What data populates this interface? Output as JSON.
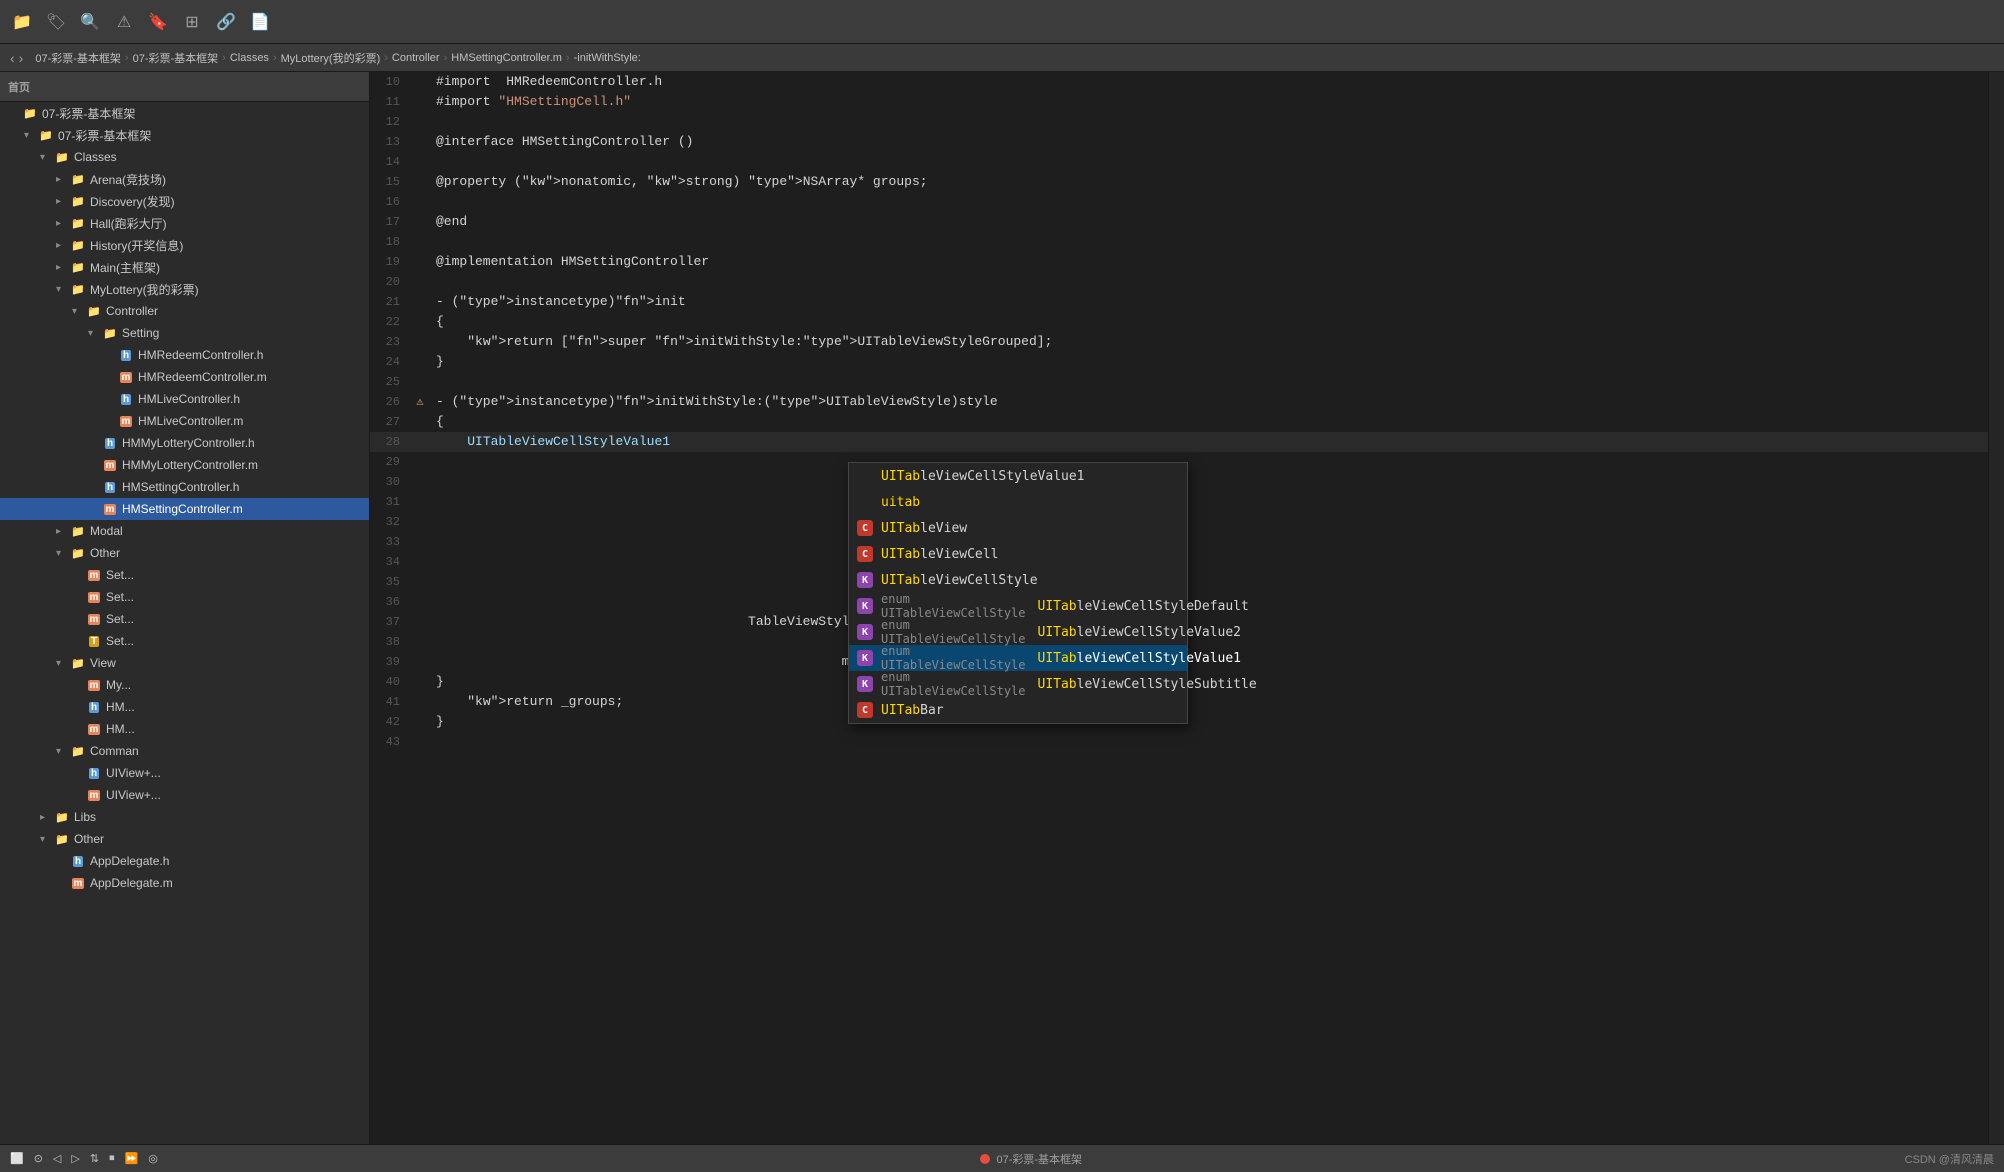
{
  "toolbar": {
    "title": "首页",
    "icons": [
      "folder",
      "tag",
      "search",
      "warning",
      "bookmark",
      "grid",
      "link",
      "doc"
    ]
  },
  "breadcrumb": {
    "nav_back": "‹",
    "nav_forward": "›",
    "items": [
      "07-彩票-基本框架",
      "07-彩票-基本框架",
      "Classes",
      "MyLottery(我的彩票)",
      "Controller",
      "HMSettingController.m",
      "-initWithStyle:"
    ]
  },
  "sidebar": {
    "header": "首页",
    "tree": [
      {
        "label": "07-彩票-基本框架",
        "indent": 1,
        "type": "project",
        "expanded": true
      },
      {
        "label": "07-彩票-基本框架",
        "indent": 2,
        "type": "folder",
        "expanded": true
      },
      {
        "label": "Classes",
        "indent": 3,
        "type": "folder",
        "expanded": true
      },
      {
        "label": "Arena(竞技场)",
        "indent": 4,
        "type": "folder",
        "expanded": false
      },
      {
        "label": "Discovery(发现)",
        "indent": 4,
        "type": "folder",
        "expanded": false
      },
      {
        "label": "Hall(跑彩大厅)",
        "indent": 4,
        "type": "folder",
        "expanded": false
      },
      {
        "label": "History(开奖信息)",
        "indent": 4,
        "type": "folder",
        "expanded": false
      },
      {
        "label": "Main(主框架)",
        "indent": 4,
        "type": "folder",
        "expanded": false
      },
      {
        "label": "MyLottery(我的彩票)",
        "indent": 4,
        "type": "folder",
        "expanded": true
      },
      {
        "label": "Controller",
        "indent": 5,
        "type": "folder",
        "expanded": true
      },
      {
        "label": "Setting",
        "indent": 6,
        "type": "folder",
        "expanded": true
      },
      {
        "label": "HMRedeemController.h",
        "indent": 7,
        "type": "file-h"
      },
      {
        "label": "HMRedeemController.m",
        "indent": 7,
        "type": "file-m"
      },
      {
        "label": "HMLiveController.h",
        "indent": 7,
        "type": "file-h"
      },
      {
        "label": "HMLiveController.m",
        "indent": 7,
        "type": "file-m"
      },
      {
        "label": "HMMyLotteryController.h",
        "indent": 6,
        "type": "file-h"
      },
      {
        "label": "HMMyLotteryController.m",
        "indent": 6,
        "type": "file-m"
      },
      {
        "label": "HMSettingController.h",
        "indent": 6,
        "type": "file-h"
      },
      {
        "label": "HMSettingController.m",
        "indent": 6,
        "type": "file-m",
        "selected": true
      },
      {
        "label": "Modal",
        "indent": 4,
        "type": "folder",
        "expanded": false
      },
      {
        "label": "Other",
        "indent": 4,
        "type": "folder",
        "expanded": true
      },
      {
        "label": "Set...",
        "indent": 5,
        "type": "file-m"
      },
      {
        "label": "Set...",
        "indent": 5,
        "type": "file-m"
      },
      {
        "label": "Set...",
        "indent": 5,
        "type": "file-m"
      },
      {
        "label": "Set...",
        "indent": 5,
        "type": "file-t"
      },
      {
        "label": "View",
        "indent": 4,
        "type": "folder",
        "expanded": true
      },
      {
        "label": "My...",
        "indent": 5,
        "type": "file-m"
      },
      {
        "label": "HM...",
        "indent": 5,
        "type": "file-h"
      },
      {
        "label": "HM...",
        "indent": 5,
        "type": "file-m"
      },
      {
        "label": "Comman",
        "indent": 4,
        "type": "folder",
        "expanded": true
      },
      {
        "label": "UIView+...",
        "indent": 5,
        "type": "file-h"
      },
      {
        "label": "UIView+...",
        "indent": 5,
        "type": "file-m"
      },
      {
        "label": "Libs",
        "indent": 3,
        "type": "folder",
        "expanded": false
      },
      {
        "label": "Other",
        "indent": 3,
        "type": "folder",
        "expanded": true
      },
      {
        "label": "AppDelegate.h",
        "indent": 4,
        "type": "file-h"
      },
      {
        "label": "AppDelegate.m",
        "indent": 4,
        "type": "file-m"
      }
    ]
  },
  "code": {
    "lines": [
      {
        "num": 10,
        "warn": false,
        "content": "#import  HMRedeemController.h"
      },
      {
        "num": 11,
        "warn": false,
        "content": "#import \"HMSettingCell.h\""
      },
      {
        "num": 12,
        "warn": false,
        "content": ""
      },
      {
        "num": 13,
        "warn": false,
        "content": "@interface HMSettingController ()"
      },
      {
        "num": 14,
        "warn": false,
        "content": ""
      },
      {
        "num": 15,
        "warn": false,
        "content": "@property (nonatomic, strong) NSArray* groups;"
      },
      {
        "num": 16,
        "warn": false,
        "content": ""
      },
      {
        "num": 17,
        "warn": false,
        "content": "@end"
      },
      {
        "num": 18,
        "warn": false,
        "content": ""
      },
      {
        "num": 19,
        "warn": false,
        "content": "@implementation HMSettingController"
      },
      {
        "num": 20,
        "warn": false,
        "content": ""
      },
      {
        "num": 21,
        "warn": false,
        "content": "- (instancetype)init"
      },
      {
        "num": 22,
        "warn": false,
        "content": "{"
      },
      {
        "num": 23,
        "warn": false,
        "content": "    return [super initWithStyle:UITableViewStyleGrouped];"
      },
      {
        "num": 24,
        "warn": false,
        "content": "}"
      },
      {
        "num": 25,
        "warn": false,
        "content": ""
      },
      {
        "num": 26,
        "warn": true,
        "content": "- (instancetype)initWithStyle:(UITableViewStyle)style"
      },
      {
        "num": 27,
        "warn": false,
        "content": "{"
      },
      {
        "num": 28,
        "warn": false,
        "content": "    UITableViewCellStyleValue1"
      },
      {
        "num": 29,
        "warn": false,
        "content": ""
      },
      {
        "num": 30,
        "warn": false,
        "content": ""
      },
      {
        "num": 31,
        "warn": false,
        "content": ""
      },
      {
        "num": 32,
        "warn": false,
        "content": ""
      },
      {
        "num": 33,
        "warn": false,
        "content": ""
      },
      {
        "num": 34,
        "warn": false,
        "content": ""
      },
      {
        "num": 35,
        "warn": false,
        "content": ""
      },
      {
        "num": 36,
        "warn": false,
        "content": ""
      },
      {
        "num": 37,
        "warn": false,
        "content": "                                        TableViewStyleGrouped];"
      },
      {
        "num": 38,
        "warn": false,
        "content": ""
      },
      {
        "num": 39,
        "warn": false,
        "content": "                                                    mainBundle] pathForResource:self.plistName"
      },
      {
        "num": 40,
        "warn": false,
        "content": "}"
      },
      {
        "num": 41,
        "warn": false,
        "content": "    return _groups;"
      },
      {
        "num": 42,
        "warn": false,
        "content": "}"
      },
      {
        "num": 43,
        "warn": false,
        "content": ""
      }
    ],
    "autocomplete": {
      "items": [
        {
          "badge": "",
          "badge_type": "none",
          "left": "",
          "text": "UITableViewCellStyleValue1",
          "selected": false,
          "is_plain": true
        },
        {
          "badge": "",
          "badge_type": "none",
          "left": "",
          "text": "uitab",
          "selected": false,
          "is_plain": true
        },
        {
          "badge": "C",
          "badge_type": "c",
          "left": "",
          "text": "UITableView",
          "selected": false
        },
        {
          "badge": "C",
          "badge_type": "c",
          "left": "",
          "text": "UITableViewCell",
          "selected": false
        },
        {
          "badge": "K",
          "badge_type": "k",
          "left": "",
          "text": "UITableViewCellStyle",
          "selected": false
        },
        {
          "badge": "K",
          "badge_type": "k",
          "left": "enum UITableViewCellStyle",
          "text": "UITableViewCellStyleDefault",
          "selected": false
        },
        {
          "badge": "K",
          "badge_type": "k",
          "left": "enum UITableViewCellStyle",
          "text": "UITableViewCellStyleValue2",
          "selected": false
        },
        {
          "badge": "K",
          "badge_type": "k",
          "left": "enum UITableViewCellStyle",
          "text": "UITableViewCellStyleValue1",
          "selected": true
        },
        {
          "badge": "K",
          "badge_type": "k",
          "left": "enum UITableViewCellStyle",
          "text": "UITableViewCellStyleSubtitle",
          "selected": false
        },
        {
          "badge": "C",
          "badge_type": "c",
          "left": "",
          "text": "UITabBar",
          "selected": false
        }
      ]
    }
  },
  "bottom_bar": {
    "icons": [
      "square",
      "circle",
      "arrow-left",
      "arrow-right",
      "arrows",
      "stop",
      "forward",
      "target"
    ],
    "project": "07-彩票-基本框架",
    "watermark": "CSDN @清风清晨"
  }
}
